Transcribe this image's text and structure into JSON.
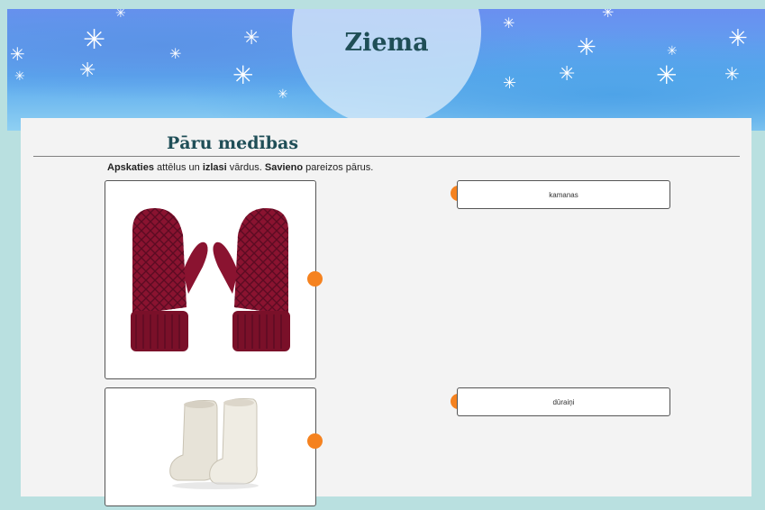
{
  "banner": {
    "title": "Ziema"
  },
  "activity": {
    "title": "Pāru medības",
    "instruction": {
      "w1": "Apskaties",
      "t1": " attēlus un ",
      "w2": "izlasi",
      "t2": " vārdus. ",
      "w3": "Savieno",
      "t3": " pareizos pārus."
    }
  },
  "items": {
    "images": [
      {
        "icon": "mittens-icon"
      },
      {
        "icon": "felt-boots-icon"
      }
    ],
    "words": [
      "kamanas",
      "dūraiņi"
    ]
  },
  "colors": {
    "accent": "#f5821f",
    "title": "#1f4e57",
    "background": "#b9e0e0"
  }
}
